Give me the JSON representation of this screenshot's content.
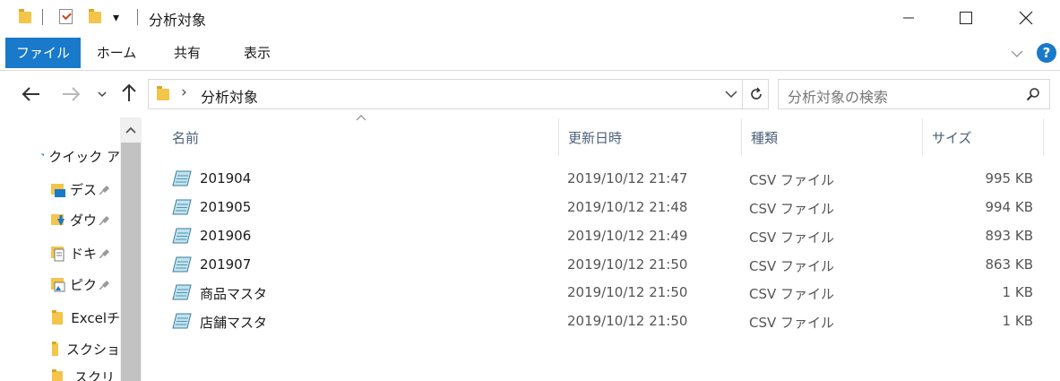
{
  "window": {
    "title": "分析対象",
    "minimize": "—",
    "maximize": "☐",
    "close": "✕"
  },
  "quick_access": {
    "dropdown_glyph": "▾"
  },
  "ribbon": {
    "tabs": [
      {
        "label": "ファイル"
      },
      {
        "label": "ホーム"
      },
      {
        "label": "共有"
      },
      {
        "label": "表示"
      }
    ],
    "expand_glyph": "⌵",
    "help_label": "?"
  },
  "nav": {
    "back": "←",
    "forward": "→",
    "recent": "⌄",
    "up": "↑"
  },
  "address": {
    "chevron": "›",
    "path": "分析対象",
    "refresh": "↻"
  },
  "search": {
    "placeholder": "分析対象の検索"
  },
  "navpane": {
    "quick_access_label": "クイック ア",
    "items": [
      {
        "label": "デス",
        "icon": "desktop-icon",
        "pinned": true
      },
      {
        "label": "ダウ",
        "icon": "download-folder-icon",
        "pinned": true
      },
      {
        "label": "ドキ",
        "icon": "document-icon",
        "pinned": true
      },
      {
        "label": "ピク",
        "icon": "picture-icon",
        "pinned": true
      },
      {
        "label": "Excelチ",
        "icon": "folder-icon",
        "pinned": false
      },
      {
        "label": "スクショ",
        "icon": "folder-icon",
        "pinned": false
      },
      {
        "label": "スクリ",
        "icon": "folder-icon",
        "pinned": false
      }
    ],
    "pin_glyph": "📌",
    "scroll_up": "▲"
  },
  "columns": {
    "sort_glyph": "⌃",
    "name": "名前",
    "date": "更新日時",
    "type": "種類",
    "size": "サイズ"
  },
  "files": [
    {
      "name": "201904",
      "date": "2019/10/12 21:47",
      "type": "CSV ファイル",
      "size": "995 KB"
    },
    {
      "name": "201905",
      "date": "2019/10/12 21:48",
      "type": "CSV ファイル",
      "size": "994 KB"
    },
    {
      "name": "201906",
      "date": "2019/10/12 21:49",
      "type": "CSV ファイル",
      "size": "893 KB"
    },
    {
      "name": "201907",
      "date": "2019/10/12 21:50",
      "type": "CSV ファイル",
      "size": "863 KB"
    },
    {
      "name": "商品マスタ",
      "date": "2019/10/12 21:50",
      "type": "CSV ファイル",
      "size": "1 KB"
    },
    {
      "name": "店舗マスタ",
      "date": "2019/10/12 21:50",
      "type": "CSV ファイル",
      "size": "1 KB"
    }
  ],
  "colors": {
    "accent": "#1979ca",
    "folder": "#f3c54a",
    "header_text": "#4c607a"
  }
}
